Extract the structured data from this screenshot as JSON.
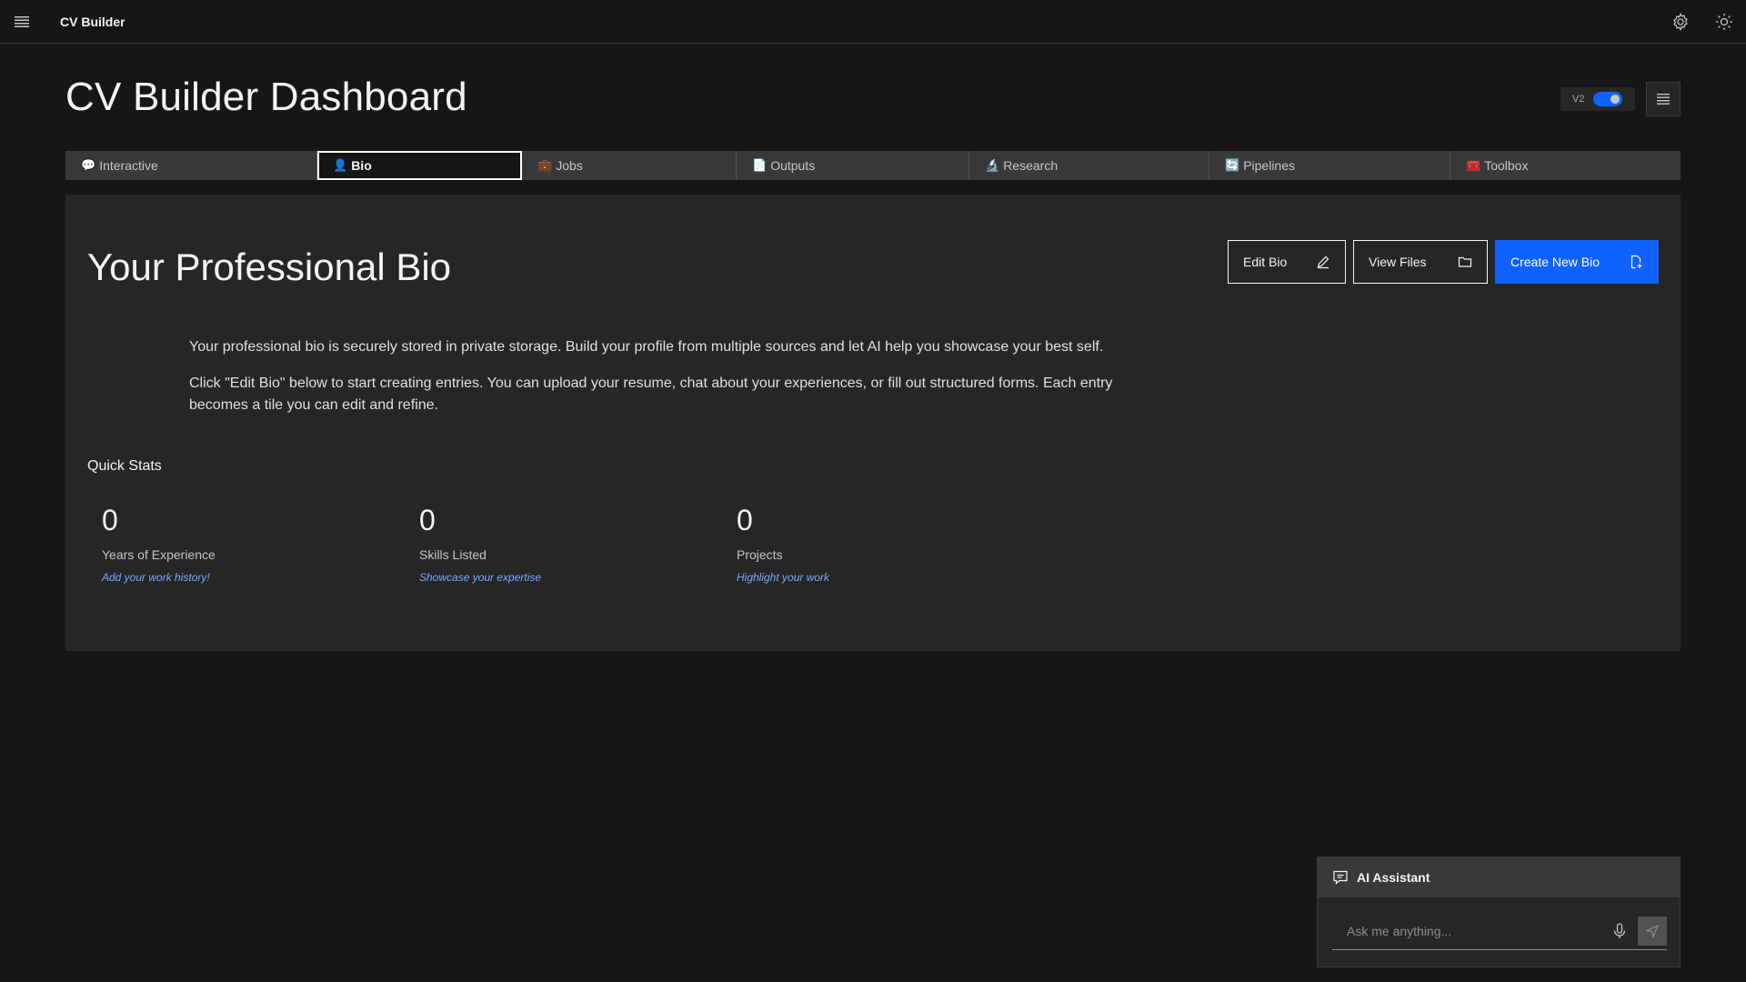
{
  "header": {
    "app_name": "CV Builder",
    "menu_icon": "hamburger-menu-icon",
    "settings_icon": "gear-icon",
    "theme_icon": "sun-icon"
  },
  "page": {
    "title": "CV Builder Dashboard",
    "version_label": "V2",
    "version_toggle_on": true,
    "view_menu_icon": "list-icon"
  },
  "tabs": [
    {
      "icon": "💬",
      "label": "Interactive",
      "active": false
    },
    {
      "icon": "👤",
      "label": "Bio",
      "active": true
    },
    {
      "icon": "💼",
      "label": "Jobs",
      "active": false
    },
    {
      "icon": "📄",
      "label": "Outputs",
      "active": false
    },
    {
      "icon": "🔬",
      "label": "Research",
      "active": false
    },
    {
      "icon": "🔄",
      "label": "Pipelines",
      "active": false
    },
    {
      "icon": "🧰",
      "label": "Toolbox",
      "active": false
    }
  ],
  "bio": {
    "title": "Your Professional Bio",
    "buttons": {
      "edit": "Edit Bio",
      "files": "View Files",
      "create": "Create New Bio"
    },
    "intro_1": "Your professional bio is securely stored in private storage. Build your profile from multiple sources and let AI help you showcase your best self.",
    "intro_2": "Click \"Edit Bio\" below to start creating entries. You can upload your resume, chat about your experiences, or fill out structured forms. Each entry becomes a tile you can edit and refine.",
    "quick_stats_title": "Quick Stats",
    "stats": [
      {
        "value": "0",
        "label": "Years of Experience",
        "hint": "Add your work history!"
      },
      {
        "value": "0",
        "label": "Skills Listed",
        "hint": "Showcase your expertise"
      },
      {
        "value": "0",
        "label": "Projects",
        "hint": "Highlight your work"
      }
    ]
  },
  "assistant": {
    "title": "AI Assistant",
    "placeholder": "Ask me anything...",
    "value": ""
  },
  "colors": {
    "accent": "#0f62fe",
    "link": "#78a9ff",
    "background": "#161616",
    "panel": "#262626"
  }
}
